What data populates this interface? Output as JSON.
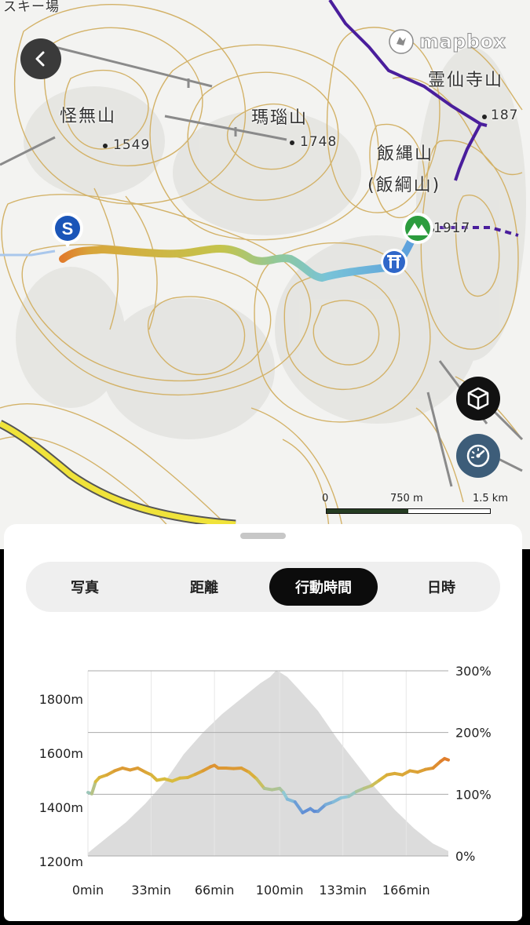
{
  "map": {
    "partial_label": "スキー場",
    "peaks": [
      {
        "name": "怪無山",
        "elevation": "1549"
      },
      {
        "name": "瑪瑙山",
        "elevation": "1748"
      },
      {
        "name": "飯縄山",
        "alt_name": "(飯綱山)",
        "elevation": "1917"
      },
      {
        "name": "霊仙寺山",
        "elevation": "187"
      }
    ],
    "start_marker": "S",
    "attribution": "mapbox",
    "scale": {
      "zero": "0",
      "mid": "750 m",
      "max": "1.5 km"
    }
  },
  "buttons": {
    "back_icon": "chevron-left-icon",
    "view3d_icon": "cube-icon",
    "speed_icon": "speedometer-icon"
  },
  "tabs": [
    {
      "label": "写真",
      "active": false
    },
    {
      "label": "距離",
      "active": false
    },
    {
      "label": "行動時間",
      "active": true
    },
    {
      "label": "日時",
      "active": false
    }
  ],
  "chart_data": {
    "type": "line",
    "x_unit": "min",
    "x_ticks": [
      "0min",
      "33min",
      "66min",
      "100min",
      "133min",
      "166min"
    ],
    "y_left_ticks": [
      "1200m",
      "1400m",
      "1600m",
      "1800m"
    ],
    "y_left_range": [
      1200,
      1800
    ],
    "y_right_ticks": [
      "0%",
      "100%",
      "200%",
      "300%"
    ],
    "y_right_range": [
      0,
      300
    ],
    "series": [
      {
        "x": [
          0,
          2,
          4,
          6,
          10,
          14,
          18,
          22,
          26,
          30,
          33,
          36,
          40,
          44,
          48,
          52,
          56,
          60,
          64,
          66,
          68,
          72,
          76,
          80,
          84,
          88,
          92,
          96,
          100,
          102,
          104,
          108,
          112,
          116,
          118,
          120,
          124,
          128,
          132,
          136,
          140,
          144,
          148,
          152,
          156,
          160,
          164,
          168,
          172,
          176,
          180,
          184,
          186,
          188
        ],
        "y": [
          1455,
          1450,
          1495,
          1510,
          1520,
          1535,
          1545,
          1538,
          1545,
          1530,
          1520,
          1500,
          1505,
          1497,
          1508,
          1510,
          1522,
          1535,
          1550,
          1555,
          1545,
          1545,
          1543,
          1545,
          1530,
          1505,
          1470,
          1465,
          1470,
          1455,
          1430,
          1420,
          1380,
          1395,
          1385,
          1385,
          1410,
          1420,
          1435,
          1440,
          1458,
          1470,
          1480,
          1500,
          1520,
          1525,
          1520,
          1535,
          1530,
          1540,
          1545,
          1570,
          1580,
          1575
        ]
      },
      {
        "name": "gradient-area",
        "x": [
          0,
          10,
          20,
          30,
          40,
          50,
          60,
          70,
          80,
          90,
          95,
          98,
          100,
          104,
          110,
          120,
          130,
          140,
          150,
          160,
          170,
          180,
          188
        ],
        "y": [
          5,
          30,
          55,
          85,
          120,
          165,
          200,
          230,
          255,
          280,
          290,
          300,
          298,
          290,
          270,
          235,
          190,
          150,
          110,
          75,
          45,
          20,
          8
        ]
      }
    ],
    "grid": true,
    "colors": {
      "low": "#5b87d4",
      "mid": "#8dc8d9",
      "high": "#d8bd3f",
      "peak": "#e07c2b",
      "area": "#d6d6d6"
    }
  }
}
